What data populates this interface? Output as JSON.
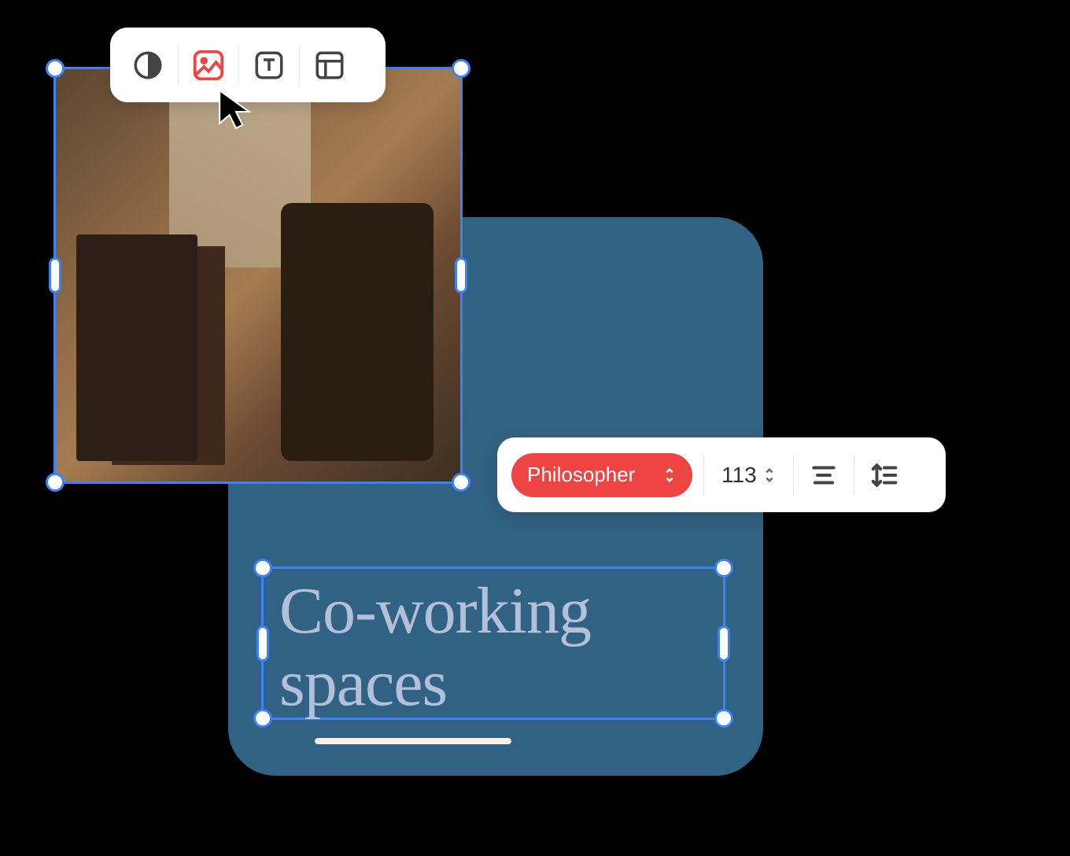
{
  "canvas": {
    "text_content": "Co-working spaces"
  },
  "top_toolbar": {
    "tools": [
      {
        "name": "contrast-icon"
      },
      {
        "name": "image-icon"
      },
      {
        "name": "text-icon"
      },
      {
        "name": "layout-icon"
      }
    ],
    "active_tool": "image-icon"
  },
  "text_toolbar": {
    "font_name": "Philosopher",
    "font_size": "113"
  }
}
